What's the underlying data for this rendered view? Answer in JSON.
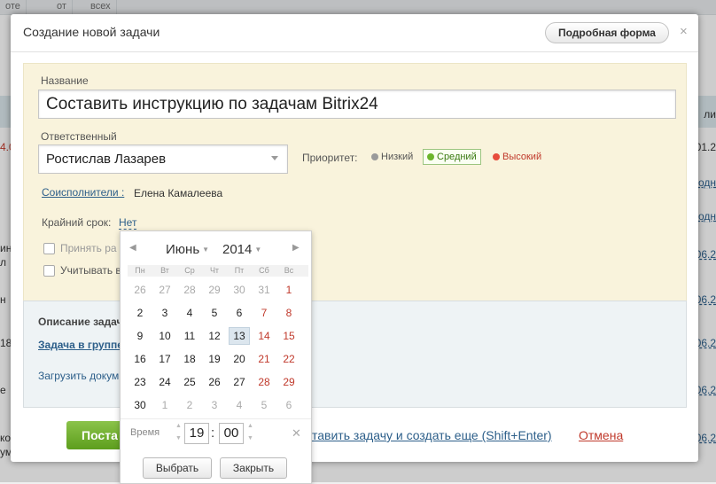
{
  "background": {
    "tabs": [
      "оте",
      "от",
      "всех"
    ],
    "left_items": [
      {
        "text": "4.0",
        "red": true
      },
      {
        "text": "ин",
        "red": false
      },
      {
        "text": "л",
        "red": false
      },
      {
        "text": "н",
        "red": false
      },
      {
        "text": "18",
        "red": false
      },
      {
        "text": "е",
        "red": false
      },
      {
        "text": "ко",
        "red": false
      },
      {
        "text": "ум",
        "red": false
      }
    ],
    "right_items": [
      "ли",
      "01.2",
      "одн",
      "одн",
      "06.2",
      "06.2",
      "06.2",
      "06.2",
      "06.2"
    ]
  },
  "dialog": {
    "title": "Создание новой задачи",
    "detailed_form_label": "Подробная форма",
    "close_label": "×"
  },
  "form": {
    "title_label": "Название",
    "title_value": "Составить инструкцию по задачам Bitrix24",
    "responsible_label": "Ответственный",
    "responsible_value": "Ростислав Лазарев",
    "priority_label": "Приоритет:",
    "priority": {
      "low": "Низкий",
      "medium": "Средний",
      "high": "Высокий",
      "selected": "medium",
      "colors": {
        "low": "#9a9a9a",
        "medium": "#6cb52d",
        "high": "#e74c3c"
      }
    },
    "coexecutors_label": "Соисполнители :",
    "coexecutor_name": "Елена Камалеева",
    "deadline_label": "Крайний срок:",
    "deadline_value": "Нет",
    "checkbox_accept": "Принять ра",
    "checkbox_account": "Учитывать в"
  },
  "description": {
    "title": "Описание задач",
    "group_link": "Задача в группе",
    "upload_label": "Загрузить докум"
  },
  "footer": {
    "save_label": "Поста",
    "save_more_label": "ставить задачу и создать еще (Shift+Enter)",
    "cancel_label": "Отмена"
  },
  "calendar": {
    "month": "Июнь",
    "year": "2014",
    "weekdays": [
      "Пн",
      "Вт",
      "Ср",
      "Чт",
      "Пт",
      "Сб",
      "Вс"
    ],
    "weeks": [
      [
        "26",
        "27",
        "28",
        "29",
        "30",
        "31",
        "1"
      ],
      [
        "2",
        "3",
        "4",
        "5",
        "6",
        "7",
        "8"
      ],
      [
        "9",
        "10",
        "11",
        "12",
        "13",
        "14",
        "15"
      ],
      [
        "16",
        "17",
        "18",
        "19",
        "20",
        "21",
        "22"
      ],
      [
        "23",
        "24",
        "25",
        "26",
        "27",
        "28",
        "29"
      ],
      [
        "30",
        "1",
        "2",
        "3",
        "4",
        "5",
        "6"
      ]
    ],
    "selected_day": "13",
    "time_label": "Время",
    "hours": "19",
    "minutes": "00",
    "select_button": "Выбрать",
    "close_button": "Закрыть"
  }
}
